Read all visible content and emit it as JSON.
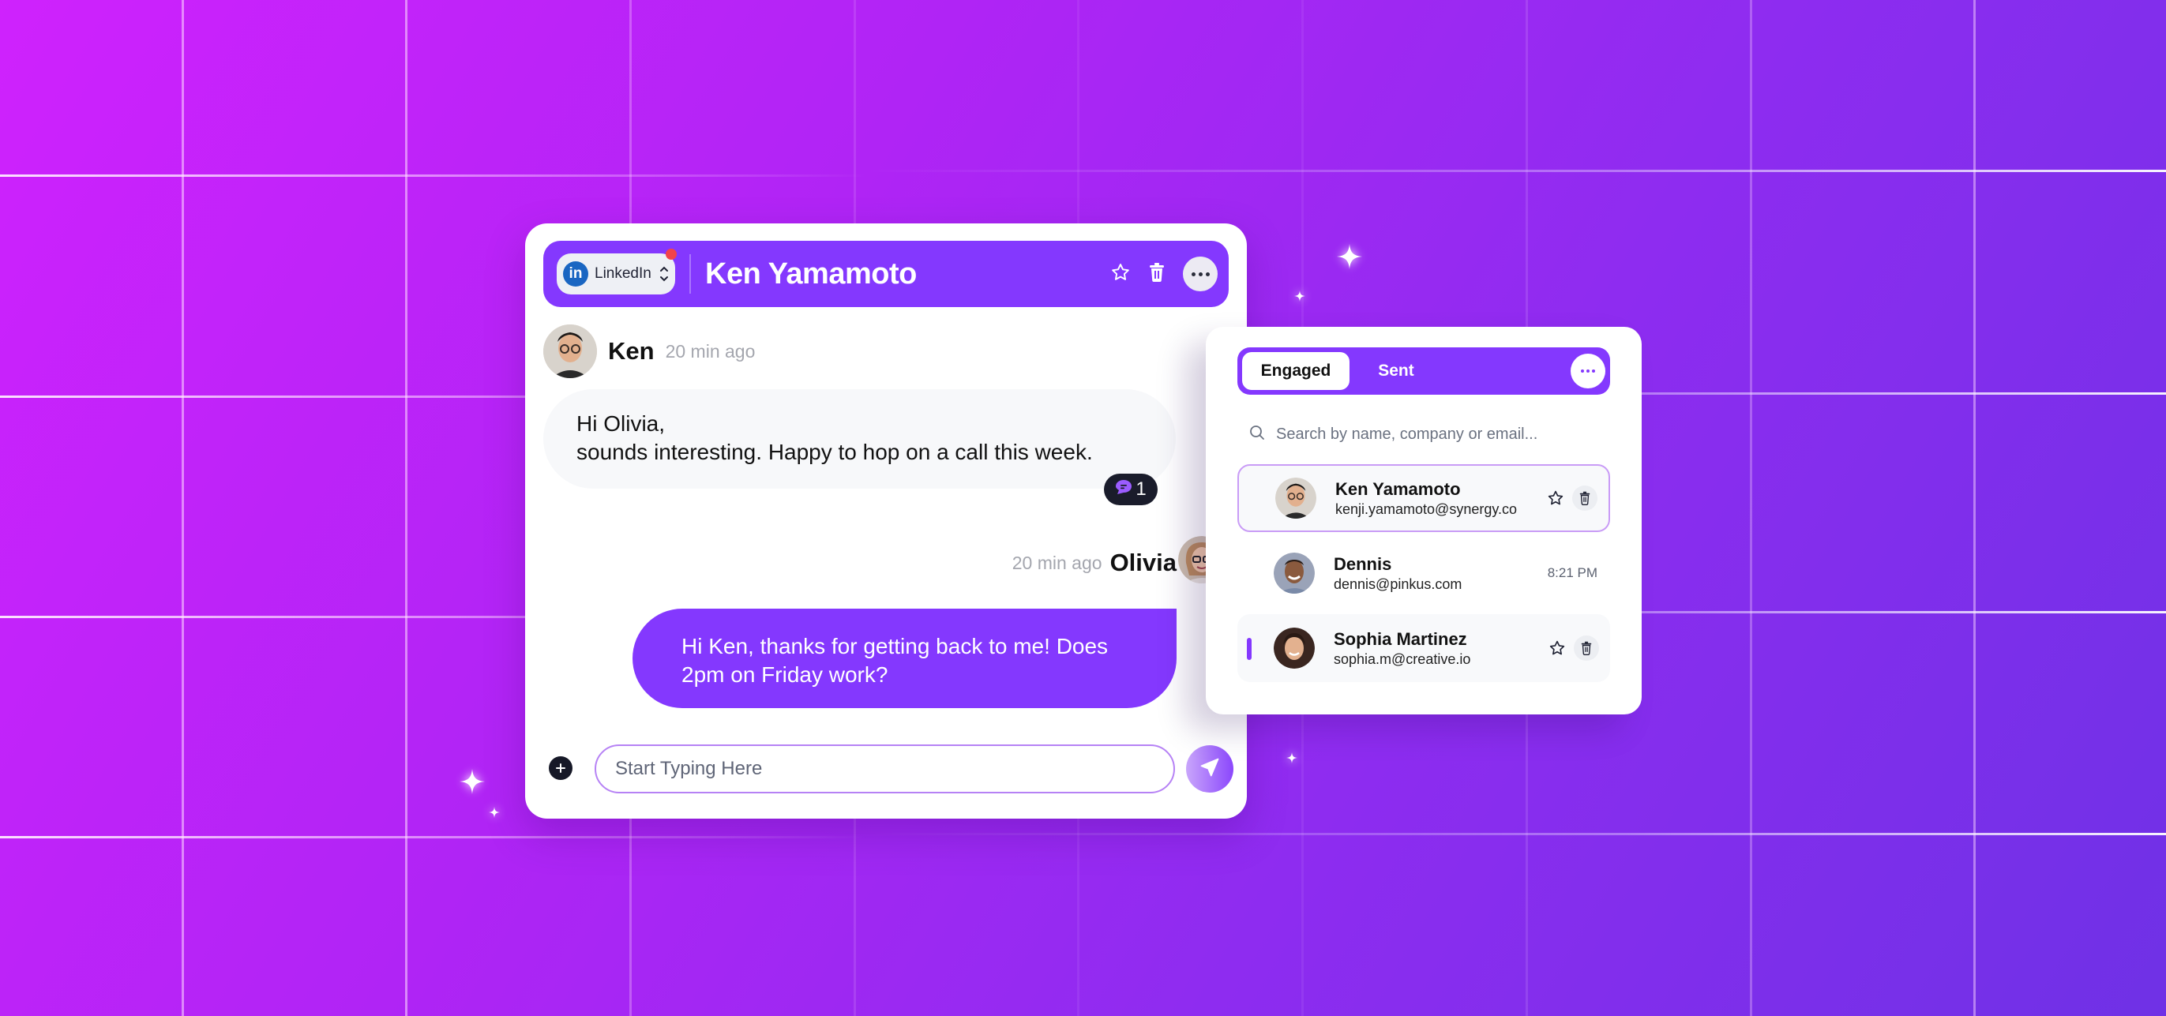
{
  "colors": {
    "brand": "#8438fe",
    "linkedin": "#1a66c2",
    "notification": "#f2434a",
    "badge_bg": "#1a1c2b"
  },
  "chat": {
    "channel": {
      "label": "LinkedIn",
      "icon": "linkedin-icon",
      "has_notification": true
    },
    "contact_name": "Ken Yamamoto",
    "header_actions": [
      "star-icon",
      "trash-icon",
      "more-icon"
    ],
    "messages": [
      {
        "direction": "incoming",
        "sender": "Ken",
        "time": "20 min ago",
        "lines": [
          "Hi Olivia,",
          "sounds interesting. Happy to hop on a call this week."
        ],
        "reaction": {
          "icon": "chat-bubble-icon",
          "count": "1"
        }
      },
      {
        "direction": "outgoing",
        "sender": "Olivia",
        "time": "20 min ago",
        "lines": [
          "Hi Ken, thanks for getting back to me! Does",
          "2pm on Friday work?"
        ]
      }
    ],
    "composer": {
      "placeholder": "Start Typing Here",
      "value": ""
    }
  },
  "inbox": {
    "tabs": [
      {
        "label": "Engaged",
        "active": true
      },
      {
        "label": "Sent",
        "active": false
      }
    ],
    "search": {
      "placeholder": "Search by name, company or email...",
      "value": ""
    },
    "contacts": [
      {
        "name": "Ken Yamamoto",
        "email": "kenji.yamamoto@synergy.co",
        "state": "selected"
      },
      {
        "name": "Dennis",
        "email": "dennis@pinkus.com",
        "time": "8:21 PM",
        "state": "default"
      },
      {
        "name": "Sophia Martinez",
        "email": "sophia.m@creative.io",
        "state": "hovered"
      }
    ]
  }
}
